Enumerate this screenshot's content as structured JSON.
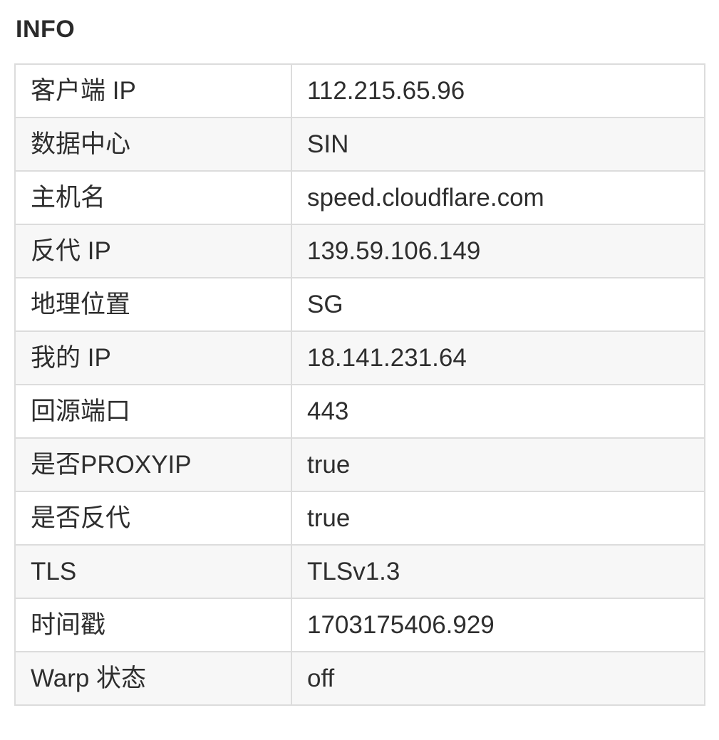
{
  "section": {
    "title": "INFO"
  },
  "info": {
    "rows": [
      {
        "key": "客户端 IP",
        "value": "112.215.65.96"
      },
      {
        "key": "数据中心",
        "value": "SIN"
      },
      {
        "key": "主机名",
        "value": "speed.cloudflare.com"
      },
      {
        "key": "反代 IP",
        "value": "139.59.106.149"
      },
      {
        "key": "地理位置",
        "value": "SG"
      },
      {
        "key": "我的 IP",
        "value": "18.141.231.64"
      },
      {
        "key": "回源端口",
        "value": "443"
      },
      {
        "key": "是否PROXYIP",
        "value": "true"
      },
      {
        "key": "是否反代",
        "value": "true"
      },
      {
        "key": "TLS",
        "value": "TLSv1.3"
      },
      {
        "key": "时间戳",
        "value": "1703175406.929"
      },
      {
        "key": "Warp 状态",
        "value": "off"
      }
    ]
  },
  "colors": {
    "border": "#dcdcdc",
    "stripe": "#f7f7f7",
    "text": "#2e2e2e"
  }
}
